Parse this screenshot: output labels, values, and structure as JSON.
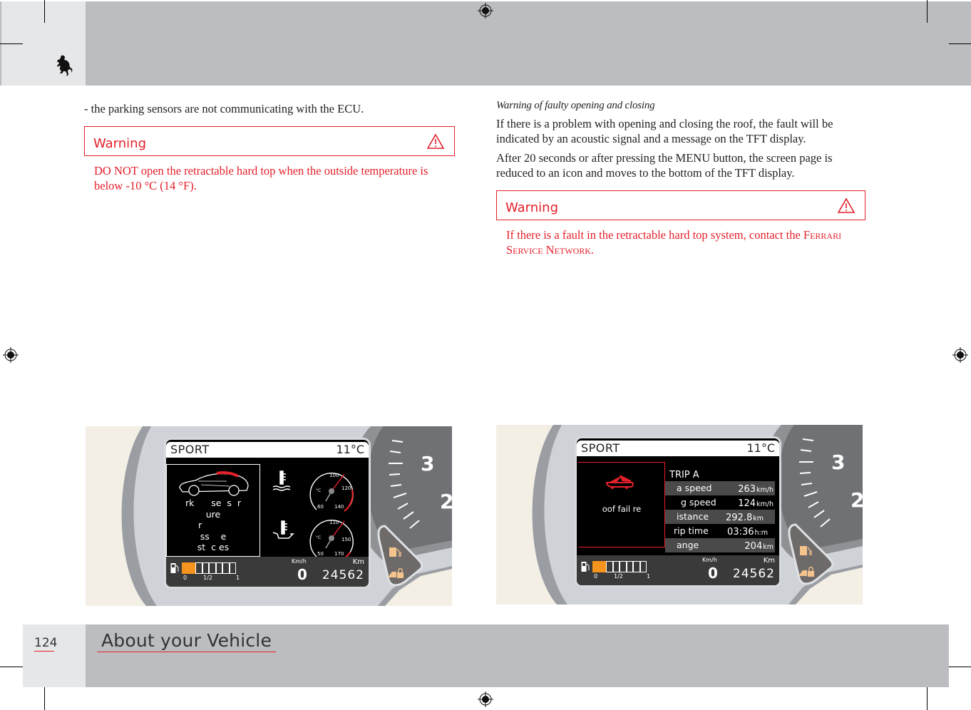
{
  "header": {
    "logo_icon": "prancing-horse-logo"
  },
  "left_column": {
    "bullet_text": "- the parking sensors are not communicating with the ECU.",
    "warning": {
      "label": "Warning",
      "icon": "warning-triangle-icon",
      "text": "DO NOT open the retractable hard top when the outside temperature is below -10 °C (14 °F)."
    }
  },
  "right_column": {
    "subheading": "Warning of faulty opening and closing",
    "paragraphs": [
      "If there is a problem with opening and closing the roof, the fault will be indicated by an acoustic signal and a message on the TFT display.",
      "After 20 seconds or after pressing the MENU button, the screen page is reduced to an icon and moves to the bottom of the TFT display."
    ],
    "warning": {
      "label": "Warning",
      "icon": "warning-triangle-icon",
      "text_prefix": "If there is a fault in the retractable hard top system, contact the ",
      "text_smallcaps": "Ferrari Service Network",
      "text_suffix": "."
    }
  },
  "dashboards": [
    {
      "mode": "SPORT",
      "outside_temp": "11°C",
      "message_lines": [
        "rk      se  s  r",
        "ure",
        "r      ",
        "ss    e",
        "st  c es"
      ],
      "water_temp_gauge": {
        "labels": [
          "100",
          "120",
          "140",
          "60",
          "°C"
        ]
      },
      "oil_temp_gauge": {
        "labels": [
          "110",
          "150",
          "170",
          "50",
          "°C"
        ]
      },
      "fuel_level_segments_on": 2,
      "fuel_level_segments_total": 8,
      "fuel_ticks": [
        "0",
        "1/2",
        "1"
      ],
      "speed_unit": "Km/h",
      "speed": "0",
      "odometer_unit": "Km",
      "odometer": "24562",
      "tach_numbers": [
        "3",
        "2"
      ]
    },
    {
      "mode": "SPORT",
      "outside_temp": "11°C",
      "message": "oof fail  re",
      "trip": {
        "title": "TRIP A",
        "rows": [
          {
            "label": "a   speed",
            "value": "263",
            "unit": "km/h"
          },
          {
            "label": "g speed",
            "value": "124",
            "unit": "km/h"
          },
          {
            "label": "istance",
            "value": "292.8",
            "unit": "km"
          },
          {
            "label": "rip time",
            "value": "03:36",
            "unit": "h:m"
          },
          {
            "label": "ange",
            "value": "204",
            "unit": "km"
          }
        ]
      },
      "fuel_level_segments_on": 2,
      "fuel_level_segments_total": 8,
      "fuel_ticks": [
        "0",
        "1/2",
        "1"
      ],
      "speed_unit": "Km/h",
      "speed": "0",
      "odometer_unit": "Km",
      "odometer": "24562",
      "tach_numbers": [
        "3",
        "2"
      ]
    }
  ],
  "footer": {
    "page_number": "124",
    "section_title": "About your Vehicle"
  },
  "colors": {
    "accent_red": "#e4202a",
    "band_gray": "#bcbdc0",
    "tab_gray": "#e6e7e9",
    "fuel_orange": "#f7941d"
  }
}
